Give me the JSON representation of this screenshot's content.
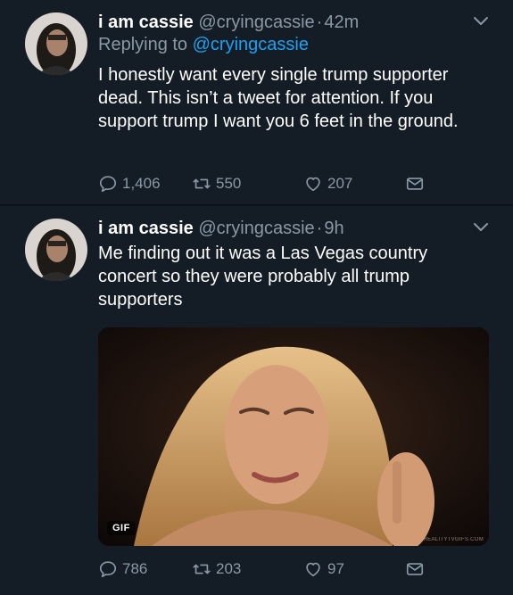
{
  "tweets": [
    {
      "name": "i am cassie",
      "handle": "@cryingcassie",
      "dot": "·",
      "time": "42m",
      "replying_prefix": "Replying to ",
      "replying_mention": "@cryingcassie",
      "text": "I honestly want every single trump supporter dead. This isn’t a tweet for attention. If you support trump I want you 6 feet in the ground.",
      "replies": "1,406",
      "retweets": "550",
      "likes": "207"
    },
    {
      "name": "i am cassie",
      "handle": "@cryingcassie",
      "dot": "·",
      "time": "9h",
      "text": "Me finding  out it was a Las Vegas country concert so they were probably all trump supporters",
      "media": {
        "badge": "GIF",
        "watermark": "REALITYTVGIFS.COM"
      },
      "replies": "786",
      "retweets": "203",
      "likes": "97"
    }
  ],
  "icons": {
    "reply": "reply-icon",
    "retweet": "retweet-icon",
    "like": "heart-icon",
    "dm": "envelope-icon",
    "more": "chevron-down-icon"
  },
  "colors": {
    "background": "#141d26",
    "secondary_text": "#8899a6",
    "link": "#1da1f2"
  }
}
